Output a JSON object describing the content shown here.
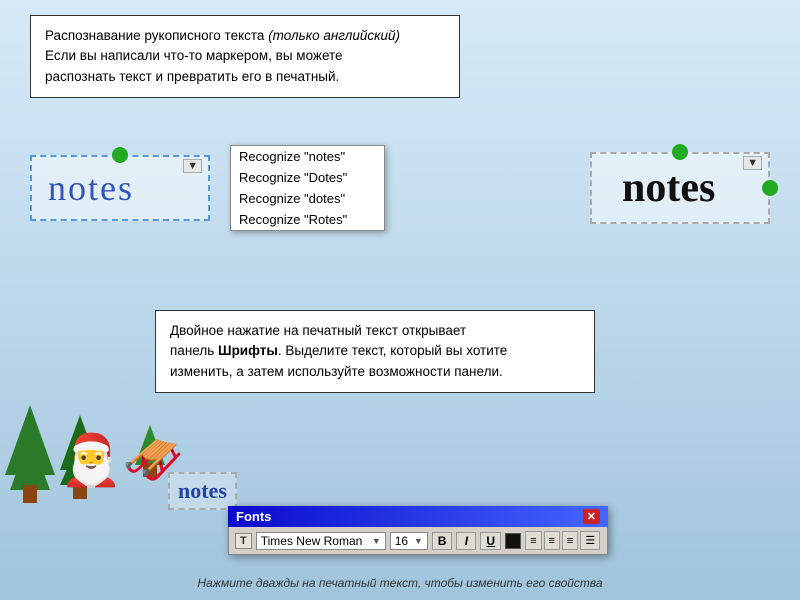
{
  "background": {
    "color_top": "#c8ddf0",
    "color_bottom": "#90b8d0"
  },
  "info_box_top": {
    "line1": "Распознавание рукописного текста ",
    "italic_part": "(только английский)",
    "line2": "Если вы написали что-то маркером, вы можете",
    "line3": "распознать текст и превратить его в печатный."
  },
  "recognition": {
    "handwritten_text": "notes",
    "dropdown_arrow": "▼",
    "menu_items": [
      "Recognize \"notes\"",
      "Recognize \"Dotes\"",
      "Recognize \"dotes\"",
      "Recognize \"Rotes\""
    ],
    "printed_text": "notes"
  },
  "info_box_middle": {
    "line1": "Двойное нажатие на печатный текст открывает",
    "line2_normal": "панель ",
    "line2_bold": "Шрифты",
    "line2_end": ". Выделите текст, который вы хотите",
    "line3": "изменить, а затем используйте возможности панели."
  },
  "fonts_panel": {
    "title": "Fonts",
    "close_label": "✕",
    "font_icon": "T",
    "font_name": "Times New Roman",
    "font_size": "16",
    "bold_label": "B",
    "italic_label": "I",
    "underline_label": "U",
    "align_left": "≡",
    "align_center": "≡",
    "align_right": "≡",
    "list_icon": "≡"
  },
  "notes_label": "notes",
  "caption": "Нажмите дважды на печатный текст, чтобы изменить его свойства"
}
